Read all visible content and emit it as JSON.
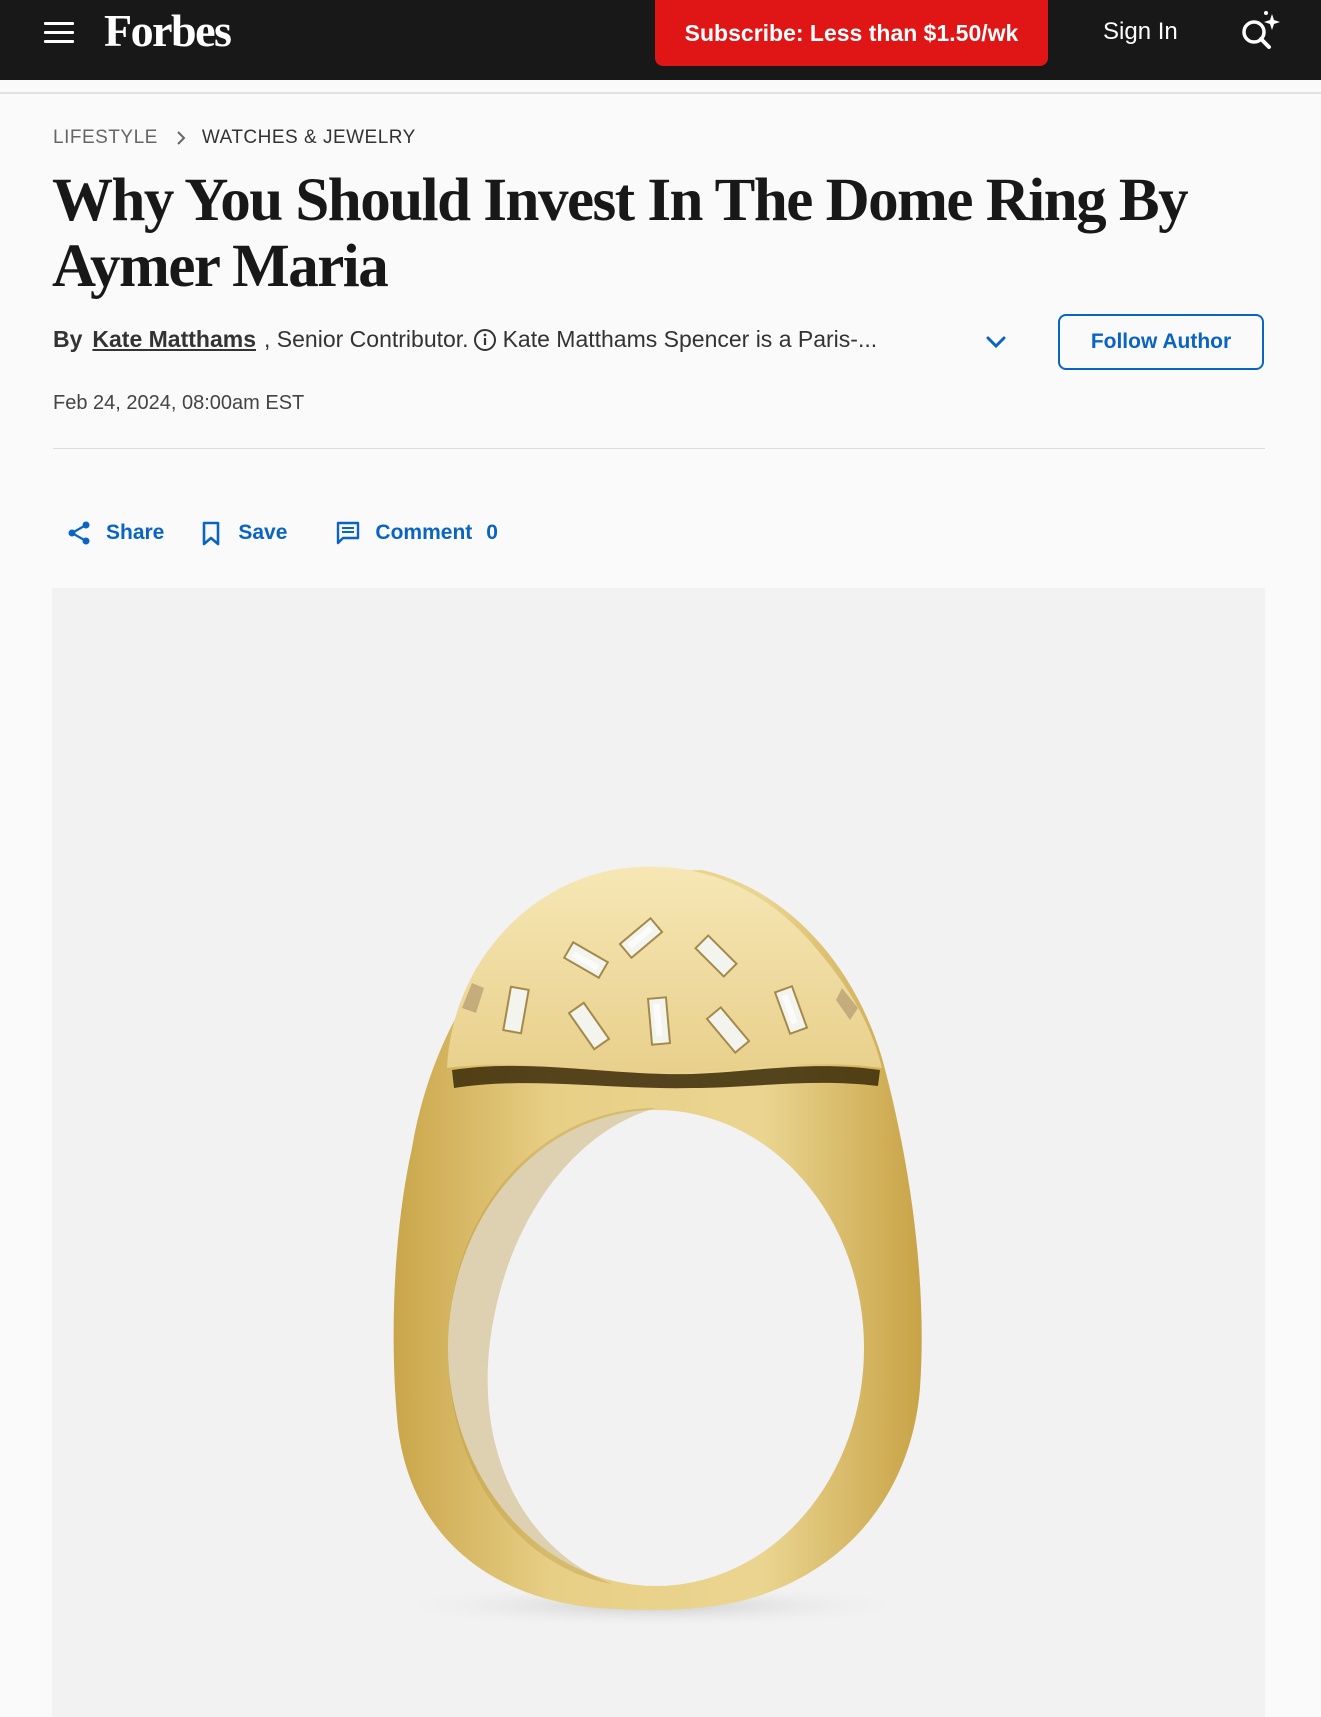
{
  "nav": {
    "logo": "Forbes",
    "subscribe_label": "Subscribe: Less than $1.50/wk",
    "signin_label": "Sign In"
  },
  "breadcrumb": {
    "section": "LIFESTYLE",
    "subsection": "WATCHES & JEWELRY"
  },
  "article": {
    "title": "Why You Should Invest In The Dome Ring By Aymer Maria",
    "by_label": "By",
    "author": "Kate Matthams",
    "role": ", Senior Contributor.",
    "bio": "Kate Matthams Spencer is a Paris-...",
    "follow_label": "Follow Author",
    "date": "Feb 24, 2024, 08:00am EST"
  },
  "actions": {
    "share_label": "Share",
    "save_label": "Save",
    "comment_label": "Comment",
    "comment_count": "0"
  },
  "colors": {
    "nav_bg": "#181818",
    "subscribe_red": "#e01515",
    "link_blue": "#0a65c2",
    "image_bg": "#f2f2f2",
    "gold": "#e3c672"
  },
  "icons": [
    "menu-icon",
    "search-sparkle-icon",
    "chevron-right-icon",
    "info-icon",
    "chevron-down-icon",
    "share-icon",
    "bookmark-icon",
    "comment-icon"
  ]
}
